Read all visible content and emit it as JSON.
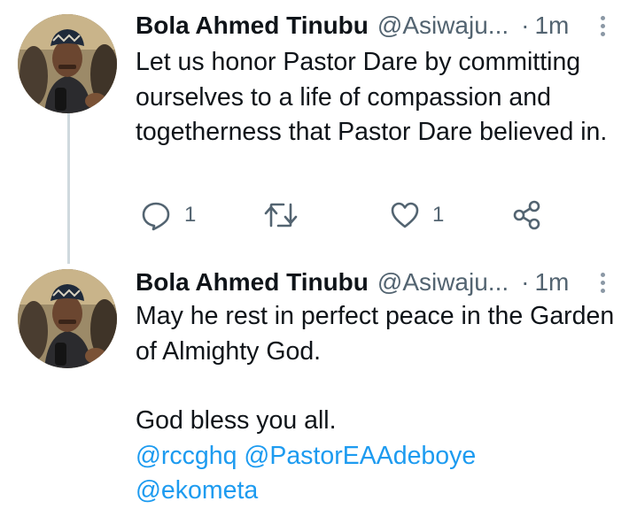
{
  "tweets": [
    {
      "author_name": "Bola Ahmed Tinubu",
      "handle": "@Asiwaju...",
      "separator": "·",
      "time": "1m",
      "text": "Let us honor Pastor Dare by committing ourselves to a life of compassion and togetherness that Pastor Dare believed in.",
      "reply_count": "1",
      "like_count": "1"
    },
    {
      "author_name": "Bola Ahmed Tinubu",
      "handle": "@Asiwaju...",
      "separator": "·",
      "time": "1m",
      "text_line_1": "May he rest in perfect peace in the Garden of Almighty God.",
      "text_line_2": "God bless you all.",
      "mentions": [
        "@rccghq @PastorEAAdeboye",
        "@ekometa"
      ]
    }
  ],
  "icons": {
    "reply": "reply-icon",
    "retweet": "retweet-icon",
    "like": "heart-icon",
    "share": "share-icon",
    "more": "more-vertical-icon"
  },
  "colors": {
    "text": "#0f1419",
    "secondary": "#536471",
    "link": "#1d9bf0",
    "thread_line": "#cfd9de"
  }
}
